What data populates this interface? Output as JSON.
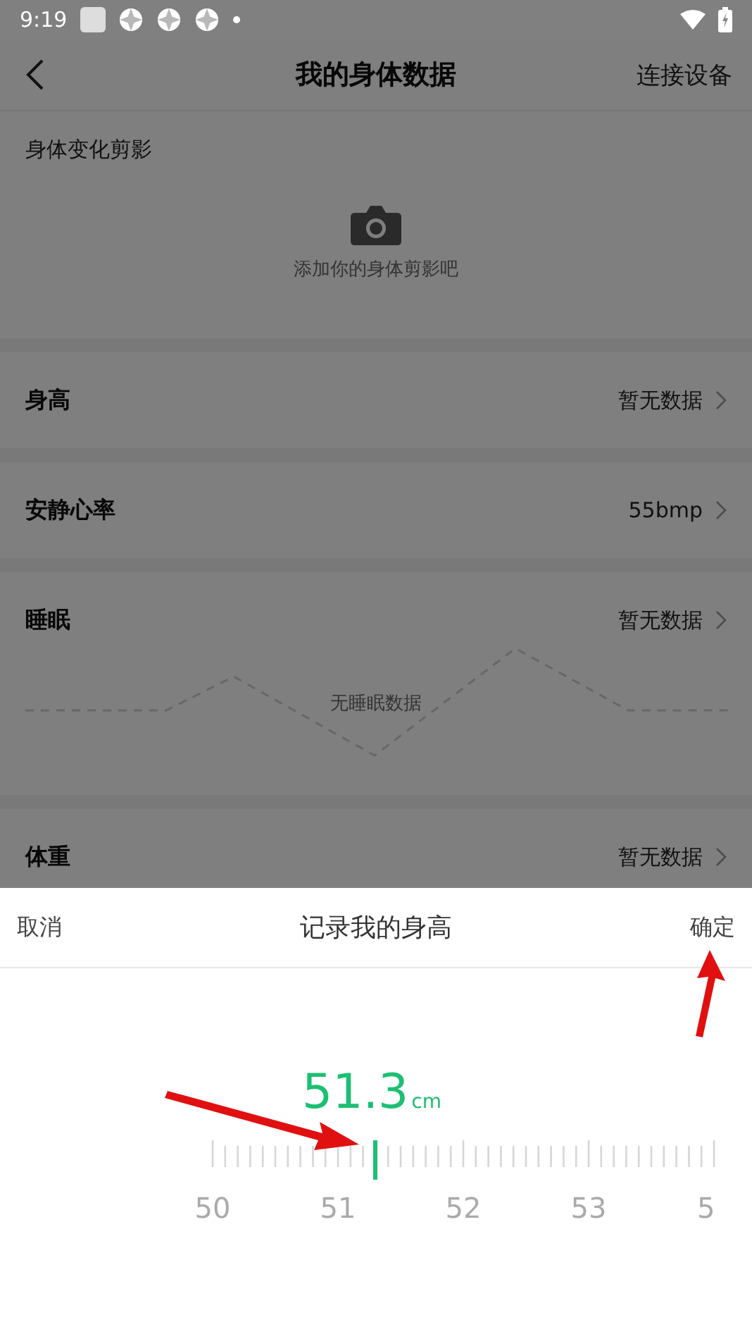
{
  "status_bar": {
    "time": "9:19"
  },
  "header": {
    "title": "我的身体数据",
    "action": "连接设备"
  },
  "photo_section": {
    "title": "身体变化剪影",
    "hint": "添加你的身体剪影吧"
  },
  "rows": [
    {
      "kind": "plain",
      "label": "身高",
      "value": "暂无数据"
    },
    {
      "kind": "plain",
      "label": "安静心率",
      "value": "55bmp"
    },
    {
      "kind": "chart",
      "label": "睡眠",
      "value": "暂无数据",
      "empty_text": "无睡眠数据"
    },
    {
      "kind": "plain",
      "label": "体重",
      "value": "暂无数据"
    }
  ],
  "sheet": {
    "cancel": "取消",
    "title": "记录我的身高",
    "confirm": "确定",
    "value": "51.3",
    "unit": "cm",
    "ruler_labels": [
      "50",
      "51",
      "52",
      "53",
      "5"
    ]
  }
}
